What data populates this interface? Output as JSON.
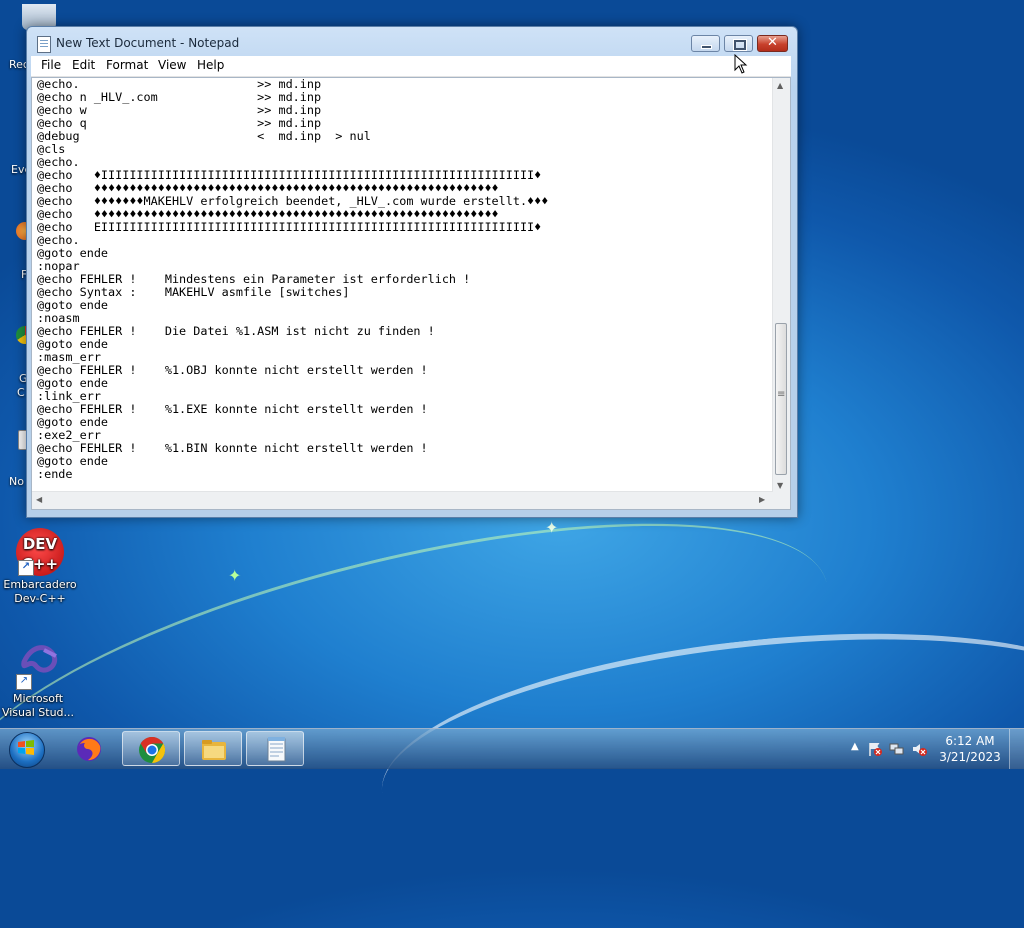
{
  "window": {
    "title": "New Text Document - Notepad"
  },
  "menu": [
    "File",
    "Edit",
    "Format",
    "View",
    "Help"
  ],
  "editor": {
    "lines": [
      "@echo.                         >> md.inp",
      "@echo n _HLV_.com              >> md.inp",
      "@echo w                        >> md.inp",
      "@echo q                        >> md.inp",
      "@debug                         <  md.inp  > nul",
      "@cls",
      "@echo.",
      "@echo   ♦IIIIIIIIIIIIIIIIIIIIIIIIIIIIIIIIIIIIIIIIIIIIIIIIIIIIIIIIIIIII♦",
      "@echo   ♦♦♦♦♦♦♦♦♦♦♦♦♦♦♦♦♦♦♦♦♦♦♦♦♦♦♦♦♦♦♦♦♦♦♦♦♦♦♦♦♦♦♦♦♦♦♦♦♦♦♦♦♦♦♦♦♦",
      "@echo   ♦♦♦♦♦♦♦MAKEHLV erfolgreich beendet, _HLV_.com wurde erstellt.♦♦♦",
      "@echo   ♦♦♦♦♦♦♦♦♦♦♦♦♦♦♦♦♦♦♦♦♦♦♦♦♦♦♦♦♦♦♦♦♦♦♦♦♦♦♦♦♦♦♦♦♦♦♦♦♦♦♦♦♦♦♦♦♦",
      "@echo   EIIIIIIIIIIIIIIIIIIIIIIIIIIIIIIIIIIIIIIIIIIIIIIIIIIIIIIIIIIIII♦",
      "@echo.",
      "@goto ende",
      ":nopar",
      "@echo FEHLER !    Mindestens ein Parameter ist erforderlich !",
      "@echo Syntax :    MAKEHLV asmfile [switches]",
      "@goto ende",
      ":noasm",
      "@echo FEHLER !    Die Datei %1.ASM ist nicht zu finden !",
      "@goto ende",
      ":masm_err",
      "@echo FEHLER !    %1.OBJ konnte nicht erstellt werden !",
      "@goto ende",
      ":link_err",
      "@echo FEHLER !    %1.EXE konnte nicht erstellt werden !",
      "@goto ende",
      ":exe2_err",
      "@echo FEHLER !    %1.BIN konnte nicht erstellt werden !",
      "@goto ende",
      ":ende"
    ]
  },
  "desktop": {
    "icons": [
      {
        "label": "Embarcadero Dev-C++",
        "badge": "DEV\nC++"
      },
      {
        "label": "Microsoft Visual Stud..."
      }
    ],
    "partial_labels": [
      "Rec",
      "Eve",
      "F",
      "G",
      "C",
      "No"
    ]
  },
  "taskbar": {
    "clock_time": "6:12 AM",
    "clock_date": "3/21/2023"
  }
}
